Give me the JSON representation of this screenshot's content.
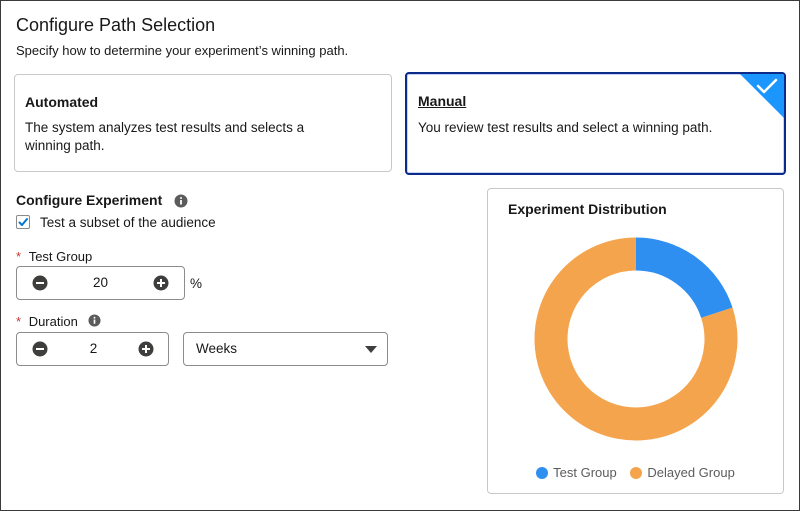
{
  "header": {
    "title": "Configure Path Selection",
    "subtitle": "Specify how to determine your experiment’s winning path."
  },
  "path_options": {
    "automated": {
      "title": "Automated",
      "description": "The system analyzes test results and selects a winning path.",
      "selected": false
    },
    "manual": {
      "title": "Manual",
      "description": "You review test results and select a winning path.",
      "selected": true
    }
  },
  "experiment": {
    "heading": "Configure Experiment",
    "subset_label": "Test a subset of the audience",
    "subset_checked": true,
    "test_group": {
      "required_mark": "*",
      "label": "Test Group",
      "value": "20",
      "unit": "%"
    },
    "duration": {
      "required_mark": "*",
      "label": "Duration",
      "value": "2",
      "unit_selected": "Weeks"
    }
  },
  "colors": {
    "accent": "#0b2a8a",
    "check_blue": "#1b96ff",
    "test_group": "#2e8ff0",
    "delayed_group": "#f4a44c"
  },
  "chart_data": {
    "type": "pie",
    "title": "Experiment Distribution",
    "categories": [
      "Test Group",
      "Delayed Group"
    ],
    "values": [
      20,
      80
    ],
    "colors": [
      "#2e8ff0",
      "#f4a44c"
    ],
    "legend": "bottom"
  }
}
